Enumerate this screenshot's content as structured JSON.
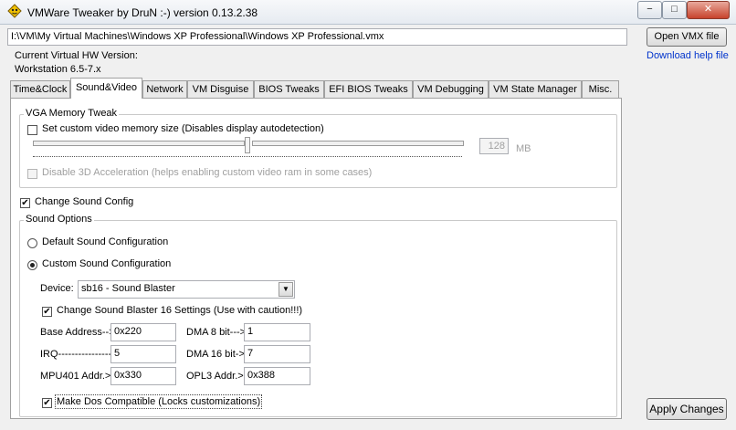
{
  "window": {
    "title": "VMWare Tweaker by DruN :-) version 0.13.2.38",
    "controls": {
      "minimize": "−",
      "maximize": "□",
      "close": "✕"
    }
  },
  "vmx_path": "I:\\VM\\My Virtual Machines\\Windows XP Professional\\Windows XP Professional.vmx",
  "open_vmx_label": "Open VMX file",
  "download_help_label": "Download help file",
  "hw_version_label": "Current Virtual HW Version:",
  "hw_version_value": "Workstation 6.5-7.x",
  "tabs": [
    "Time&Clock",
    "Sound&Video",
    "Network",
    "VM Disguise",
    "BIOS Tweaks",
    "EFI BIOS Tweaks",
    "VM Debugging",
    "VM State Manager",
    "Misc."
  ],
  "active_tab": "Sound&Video",
  "vga": {
    "group_title": "VGA Memory Tweak",
    "custom_memory_label": "Set custom video memory size (Disables display autodetection)",
    "custom_memory_checked": false,
    "memory_value": "128",
    "memory_unit": "MB",
    "disable_3d_label": "Disable 3D Acceleration (helps enabling custom video ram in some cases)",
    "disable_3d_checked": false
  },
  "sound": {
    "change_config_label": "Change Sound Config",
    "change_config_checked": true,
    "group_title": "Sound Options",
    "default_label": "Default Sound Configuration",
    "custom_label": "Custom Sound Configuration",
    "selected": "custom",
    "device_label": "Device:",
    "device_value": "sb16 - Sound Blaster",
    "sb16_label": "Change Sound Blaster 16 Settings (Use with caution!!!)",
    "sb16_checked": true,
    "fields": {
      "base_address_label": "Base Address-->",
      "base_address_value": "0x220",
      "dma8_label": "DMA 8 bit--->",
      "dma8_value": "1",
      "irq_label": "IRQ---------------->",
      "irq_value": "5",
      "dma16_label": "DMA 16 bit->",
      "dma16_value": "7",
      "mpu401_label": "MPU401 Addr.>",
      "mpu401_value": "0x330",
      "opl3_label": "OPL3 Addr.>",
      "opl3_value": "0x388"
    },
    "dos_label": "Make Dos Compatible (Locks customizations)",
    "dos_checked": true
  },
  "apply_label": "Apply Changes",
  "colors": {
    "link": "#0033cc",
    "app_icon": "#f2c200"
  }
}
